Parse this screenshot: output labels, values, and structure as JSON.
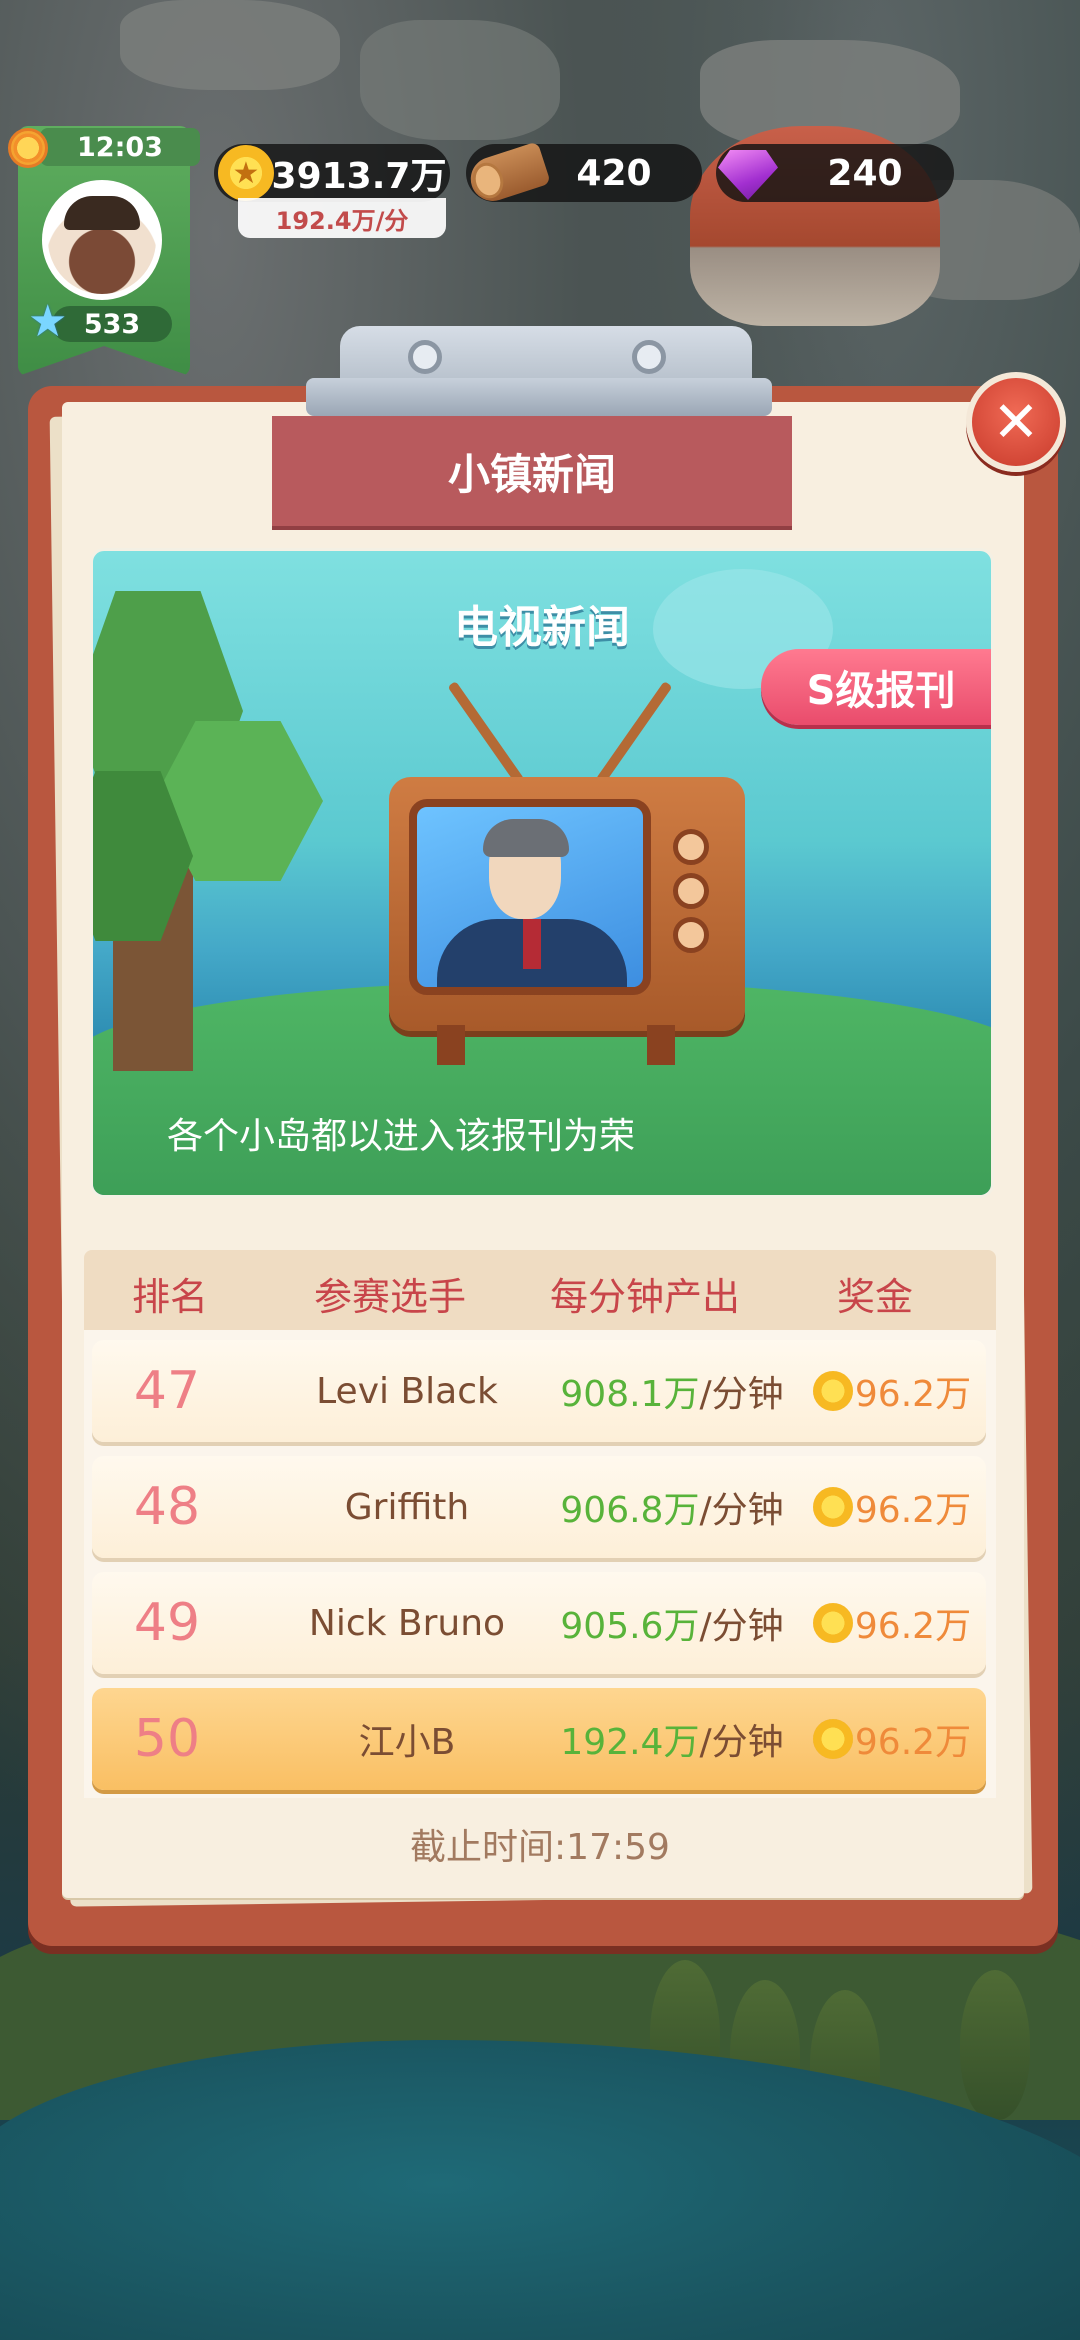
{
  "hud": {
    "time": "12:03",
    "level": "533",
    "coins": "3913.7万",
    "coin_rate": "192.4万/分",
    "wood": "420",
    "gems": "240"
  },
  "panel": {
    "title": "小镇新闻",
    "close_label": "✕"
  },
  "news": {
    "title": "电视新闻",
    "tag": "S级报刊",
    "caption": "各个小岛都以进入该报刊为荣"
  },
  "leaderboard": {
    "headers": [
      "排名",
      "参赛选手",
      "每分钟产出",
      "奖金"
    ],
    "rows": [
      {
        "rank": "47",
        "player": "Levi Black",
        "rate": "908.1万",
        "unit": "/分钟",
        "prize": "96.2万"
      },
      {
        "rank": "48",
        "player": "Griffith",
        "rate": "906.8万",
        "unit": "/分钟",
        "prize": "96.2万"
      },
      {
        "rank": "49",
        "player": "Nick Bruno",
        "rate": "905.6万",
        "unit": "/分钟",
        "prize": "96.2万"
      },
      {
        "rank": "50",
        "player": "江小B",
        "rate": "192.4万",
        "unit": "/分钟",
        "prize": "96.2万"
      }
    ],
    "deadline": "截止时间:17:59"
  },
  "colors": {
    "board": "#b9573f",
    "banner": "#b85a5d",
    "rate_green": "#58b33a",
    "rank_pink": "#ee7f86",
    "highlight_row": "#f9bf63"
  },
  "icons": [
    "sun-icon",
    "star-icon",
    "coin-icon",
    "wood-icon",
    "gem-icon",
    "close-icon",
    "tv-icon"
  ]
}
